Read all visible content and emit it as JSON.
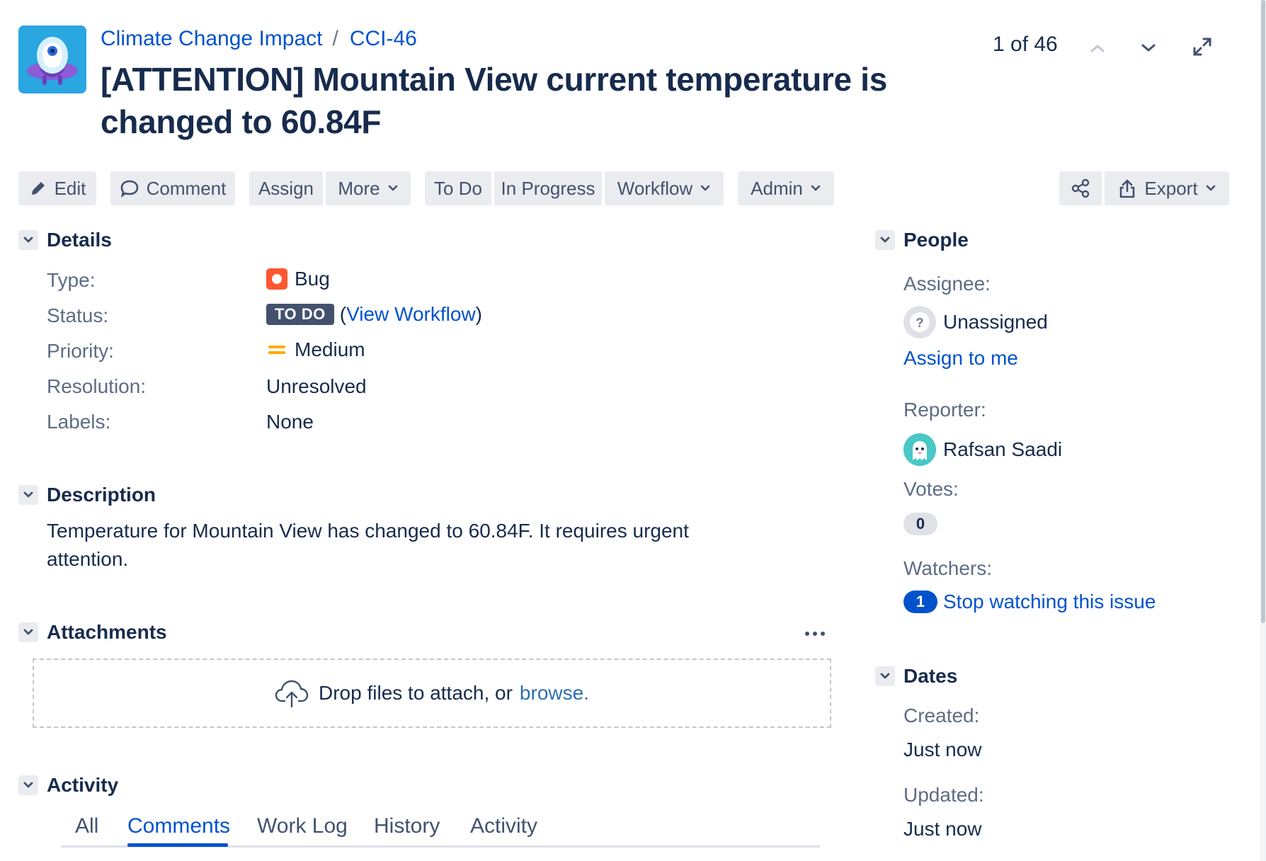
{
  "header": {
    "project_name": "Climate Change Impact",
    "issue_key": "CCI-46",
    "title": "[ATTENTION] Mountain View current temperature is changed to 60.84F",
    "pager": "1 of 46"
  },
  "toolbar": {
    "edit": "Edit",
    "comment": "Comment",
    "assign": "Assign",
    "more": "More",
    "todo": "To Do",
    "in_progress": "In Progress",
    "workflow": "Workflow",
    "admin": "Admin",
    "export": "Export"
  },
  "details": {
    "heading": "Details",
    "type_label": "Type:",
    "type_value": "Bug",
    "status_label": "Status:",
    "status_value": "TO DO",
    "view_workflow_open": "(",
    "view_workflow": "View Workflow",
    "view_workflow_close": ")",
    "priority_label": "Priority:",
    "priority_value": "Medium",
    "resolution_label": "Resolution:",
    "resolution_value": "Unresolved",
    "labels_label": "Labels:",
    "labels_value": "None"
  },
  "description": {
    "heading": "Description",
    "text": "Temperature for Mountain View has changed to 60.84F. It requires urgent attention."
  },
  "attachments": {
    "heading": "Attachments",
    "drop_text": "Drop files to attach, or",
    "browse": "browse."
  },
  "activity": {
    "heading": "Activity",
    "tabs": [
      "All",
      "Comments",
      "Work Log",
      "History",
      "Activity"
    ],
    "active_tab": "Comments"
  },
  "people": {
    "heading": "People",
    "assignee_label": "Assignee:",
    "assignee_value": "Unassigned",
    "assign_to_me": "Assign to me",
    "reporter_label": "Reporter:",
    "reporter_value": "Rafsan Saadi",
    "votes_label": "Votes:",
    "votes_count": "0",
    "watchers_label": "Watchers:",
    "watchers_count": "1",
    "stop_watching": "Stop watching this issue"
  },
  "dates": {
    "heading": "Dates",
    "created_label": "Created:",
    "created_value": "Just now",
    "updated_label": "Updated:",
    "updated_value": "Just now"
  },
  "colors": {
    "link": "#0052cc",
    "text": "#172b4d",
    "muted": "#5e6c84",
    "button_bg": "#ebecf0",
    "bug": "#ff5630",
    "priority_medium": "#ffab00",
    "project_avatar": "#2aa6e0"
  }
}
